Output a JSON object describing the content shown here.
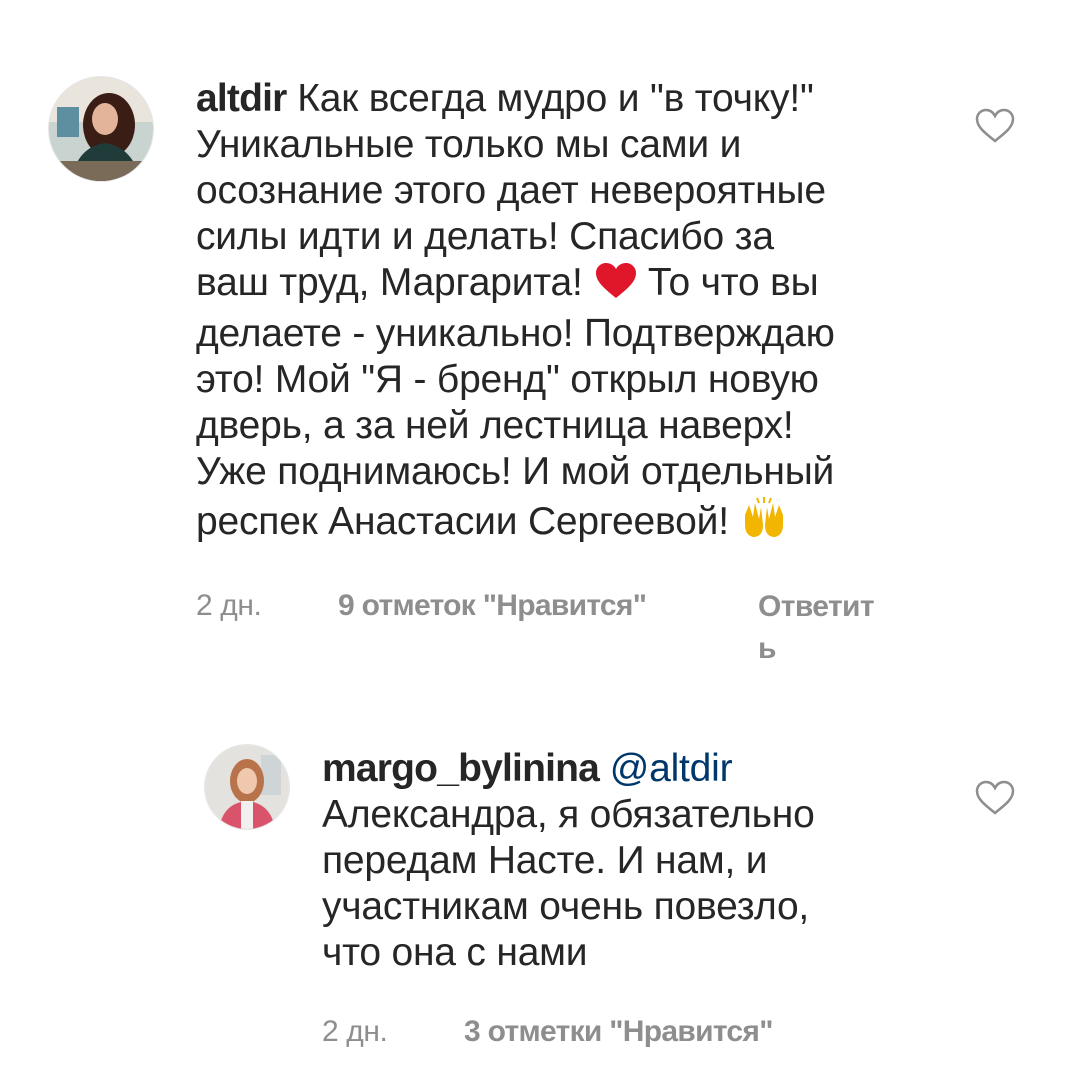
{
  "comments": [
    {
      "username": "altdir",
      "text_parts": [
        "Как всегда мудро и \"в точку!\"",
        "Уникальные только мы сами и",
        "осознание этого дает невероятные",
        "силы идти и делать! Спасибо за",
        "ваш труд, Маргарита!",
        "То что вы",
        "делаете - уникально! Подтверждаю",
        "это! Мой \"Я - бренд\" открыл новую",
        "дверь, а за ней лестница наверх!",
        "Уже поднимаюсь! И мой отдельный",
        "респек Анастасии Сергеевой!"
      ],
      "emojis": [
        "red-heart-emoji",
        "raising-hands-emoji"
      ],
      "time": "2 дн.",
      "likes": "9 отметок \"Нравится\"",
      "reply": "Ответить"
    },
    {
      "username": "margo_bylinina",
      "mention": "@altdir",
      "text_parts": [
        "Александра, я обязательно",
        "передам Насте. И нам, и",
        "участникам очень повезло,",
        "что она с нами"
      ],
      "time": "2 дн.",
      "likes": "3 отметки \"Нравится\""
    }
  ],
  "colors": {
    "text": "#262626",
    "meta": "#8e8e8e",
    "mention": "#00376b",
    "heart": "#e0162b"
  }
}
